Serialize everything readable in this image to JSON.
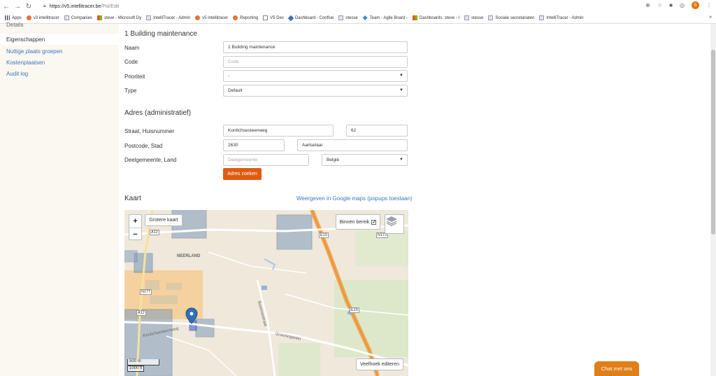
{
  "browser": {
    "url_host": "https://v5.intellitracer.be",
    "url_path": "/Poi/Edit",
    "profile_initial": "S"
  },
  "bookmarks": [
    {
      "label": "Apps",
      "icon": "apps-icon"
    },
    {
      "label": "v3 intellitracer",
      "icon": "v3-icon"
    },
    {
      "label": "Companies",
      "icon": "page-icon"
    },
    {
      "label": "steve - Microsoft Dy",
      "icon": "microsoft-icon"
    },
    {
      "label": "IntelliTracer - Admin",
      "icon": "intellitracer-icon"
    },
    {
      "label": "v5 intellitracer",
      "icon": "v5-icon"
    },
    {
      "label": "Reporting",
      "icon": "reporting-icon"
    },
    {
      "label": "V5 Dev",
      "icon": "document-icon"
    },
    {
      "label": "Dashboard - Conflue",
      "icon": "confluence-icon"
    },
    {
      "label": "stesse",
      "icon": "page-icon"
    },
    {
      "label": "Team - Agile Board -",
      "icon": "jira-icon"
    },
    {
      "label": "Dashboards: steve - I",
      "icon": "microsoft-icon"
    },
    {
      "label": "stesse",
      "icon": "page-icon"
    },
    {
      "label": "Sociale secretariaten",
      "icon": "page-icon"
    },
    {
      "label": "IntelliTracer - Admin",
      "icon": "intellitracer-icon"
    }
  ],
  "sidebar": {
    "heading": "Details",
    "items": [
      {
        "label": "Eigenschappen",
        "active": true
      },
      {
        "label": "Nuttige plaats groepen",
        "active": false
      },
      {
        "label": "Kostenplaatsen",
        "active": false
      },
      {
        "label": "Audit log",
        "active": false
      }
    ]
  },
  "form": {
    "title": "1 Building maintenance",
    "naam_label": "Naam",
    "naam_value": "1 Building maintenance",
    "code_label": "Code",
    "code_placeholder": "Code",
    "prioriteit_label": "Prioriteit",
    "prioriteit_value": "-",
    "type_label": "Type",
    "type_value": "Default"
  },
  "address": {
    "title": "Adres (administratief)",
    "straat_label": "Straat, Huisnummer",
    "straat_value": "Kontichsesteenweg",
    "huisnummer_value": "62",
    "postcode_label": "Postcode, Stad",
    "postcode_value": "2630",
    "stad_value": "Aartselaar",
    "deelgemeente_label": "Deelgemeente, Land",
    "deelgemeente_placeholder": "Deelgemeente",
    "land_value": "België",
    "search_button": "Adres zoeken"
  },
  "map": {
    "title": "Kaart",
    "google_link": "Weergeven in Google maps (popups toestaan)",
    "zoom_in": "+",
    "zoom_out": "−",
    "bigger_map": "Grotere kaart",
    "within_range": "Binnen bereik",
    "within_range_checked": true,
    "edit_polygon": "Veelhoek editeren",
    "scale_m": "500 m",
    "scale_ft": "1000 ft",
    "labels": {
      "neerland": "NEERLAND",
      "a12_top": "A12",
      "a12_bottom": "A12",
      "n177": "N177",
      "n173": "N173",
      "e19_top": "E19",
      "e19_mid": "E19",
      "kontich_street": "Kontichsesteenweg",
      "boomsestraat": "Boomsestraat",
      "groeningenlei": "Groeningenlei"
    }
  },
  "chat": {
    "label": "Chat met ons"
  },
  "colors": {
    "accent": "#e05b12",
    "link": "#3a79b7",
    "chat": "#e07e18"
  }
}
